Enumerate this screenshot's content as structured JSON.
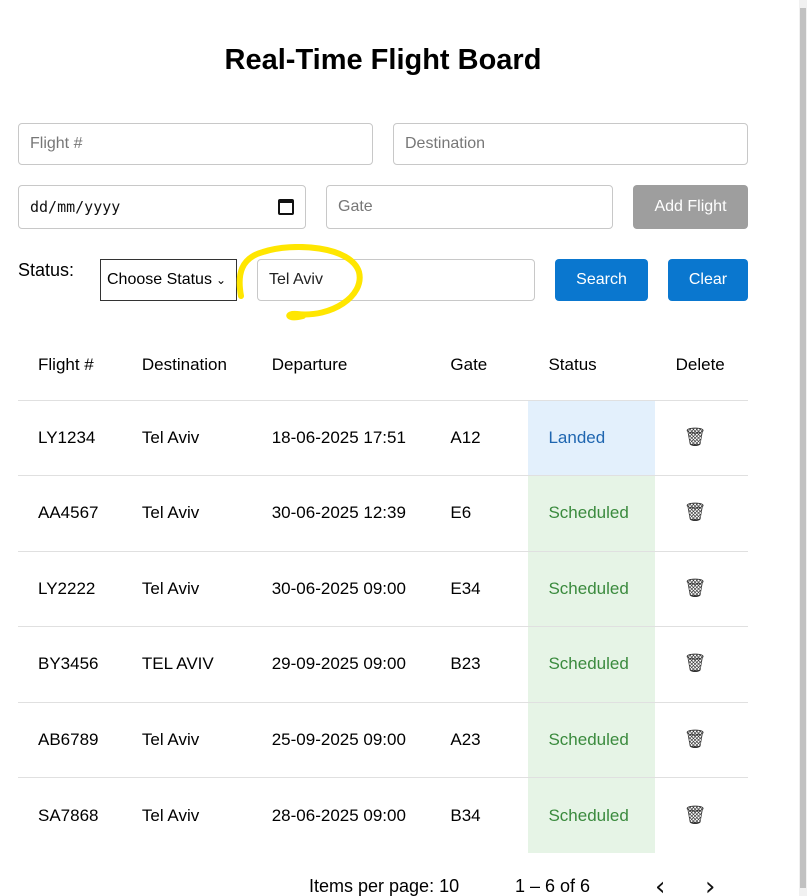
{
  "title": "Real-Time Flight Board",
  "form": {
    "flight_placeholder": "Flight #",
    "destination_placeholder": "Destination",
    "date_placeholder": "dd/mm/yyyy",
    "gate_placeholder": "Gate",
    "add_button": "Add Flight"
  },
  "filter": {
    "status_label": "Status:",
    "status_select": "Choose Status",
    "search_value": "Tel Aviv",
    "search_button": "Search",
    "clear_button": "Clear",
    "highlight_color": "#ffe600"
  },
  "table": {
    "headers": [
      "Flight #",
      "Destination",
      "Departure",
      "Gate",
      "Status",
      "Delete"
    ],
    "rows": [
      {
        "flight": "LY1234",
        "destination": "Tel Aviv",
        "departure": "18-06-2025 17:51",
        "gate": "A12",
        "status": "Landed"
      },
      {
        "flight": "AA4567",
        "destination": "Tel Aviv",
        "departure": "30-06-2025 12:39",
        "gate": "E6",
        "status": "Scheduled"
      },
      {
        "flight": "LY2222",
        "destination": "Tel Aviv",
        "departure": "30-06-2025 09:00",
        "gate": "E34",
        "status": "Scheduled"
      },
      {
        "flight": "BY3456",
        "destination": "TEL AVIV",
        "departure": "29-09-2025 09:00",
        "gate": "B23",
        "status": "Scheduled"
      },
      {
        "flight": "AB6789",
        "destination": "Tel Aviv",
        "departure": "25-09-2025 09:00",
        "gate": "A23",
        "status": "Scheduled"
      },
      {
        "flight": "SA7868",
        "destination": "Tel Aviv",
        "departure": "28-06-2025 09:00",
        "gate": "B34",
        "status": "Scheduled"
      }
    ],
    "delete_icon": "trash-icon"
  },
  "pagination": {
    "items_per_page": "Items per page: 10",
    "range": "1 – 6 of 6",
    "prev_icon": "chevron-left-icon",
    "next_icon": "chevron-right-icon"
  },
  "colors": {
    "accent": "#0a77cf",
    "landed_bg": "#e3f0fc",
    "scheduled_bg": "#e6f4e6"
  }
}
